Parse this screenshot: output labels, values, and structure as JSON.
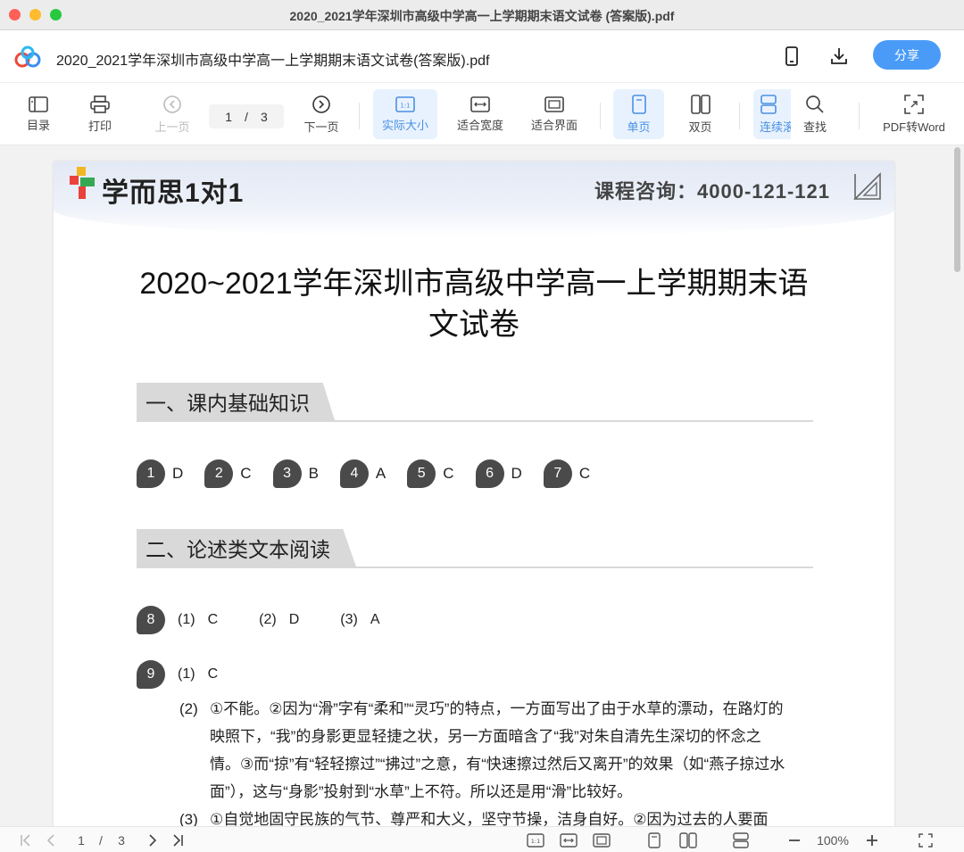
{
  "window": {
    "title": "2020_2021学年深圳市高级中学高一上学期期末语文试卷 (答案版).pdf"
  },
  "header": {
    "file_name": "2020_2021学年深圳市高级中学高一上学期期末语文试卷(答案版).pdf",
    "share_label": "分享"
  },
  "toolbar": {
    "toc": "目录",
    "print": "打印",
    "prev": "上一页",
    "page_current": "1",
    "page_sep": "/",
    "page_total": "3",
    "next": "下一页",
    "actual_size": "实际大小",
    "fit_width": "适合宽度",
    "fit_page": "适合界面",
    "single": "单页",
    "double": "双页",
    "continuous": "连续滚",
    "search": "查找",
    "to_word": "PDF转Word"
  },
  "document": {
    "brand": "学而思1对1",
    "consult": "课程咨询：4000-121-121",
    "title_line1": "2020~2021学年深圳市高级中学高一上学期期末语",
    "title_line2": "文试卷",
    "section1": "一、课内基础知识",
    "answers": [
      {
        "n": "1",
        "a": "D"
      },
      {
        "n": "2",
        "a": "C"
      },
      {
        "n": "3",
        "a": "B"
      },
      {
        "n": "4",
        "a": "A"
      },
      {
        "n": "5",
        "a": "C"
      },
      {
        "n": "6",
        "a": "D"
      },
      {
        "n": "7",
        "a": "C"
      }
    ],
    "section2": "二、论述类文本阅读",
    "q8": {
      "n": "8",
      "p1": "(1)",
      "a1": "C",
      "p2": "(2)",
      "a2": "D",
      "p3": "(3)",
      "a3": "A"
    },
    "q9": {
      "n": "9",
      "p1": "(1)",
      "a1": "C",
      "p2": "(2)",
      "t2": "①不能。②因为“滑”字有“柔和”“灵巧”的特点，一方面写出了由于水草的漂动，在路灯的映照下，“我”的身影更显轻捷之状，另一方面暗含了“我”对朱自清先生深切的怀念之情。③而“掠”有“轻轻擦过”“拂过”之意，有“快速擦过然后又离开”的效果（如“燕子掠过水面”），这与“身影”投射到“水草”上不符。所以还是用“滑”比较好。",
      "p3": "(3)",
      "t3": "①自觉地固守民族的气节、尊严和大义，坚守节操，洁身自好。②因为过去的人要面"
    }
  },
  "statusbar": {
    "page_current": "1",
    "page_sep": "/",
    "page_total": "3",
    "zoom": "100%"
  }
}
